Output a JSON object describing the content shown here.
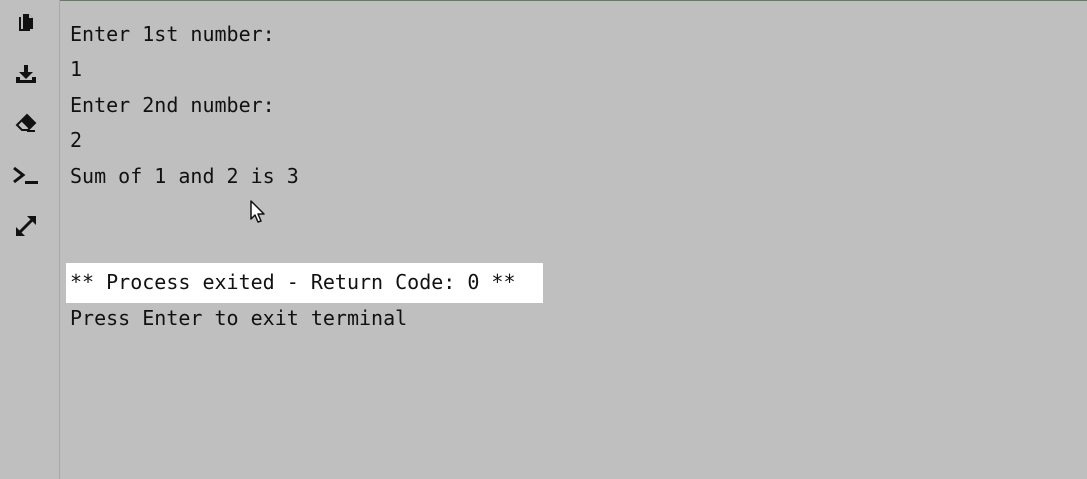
{
  "sidebar": {
    "tools": [
      {
        "icon": "copy-icon"
      },
      {
        "icon": "download-icon"
      },
      {
        "icon": "eraser-icon"
      },
      {
        "icon": "terminal-icon"
      },
      {
        "icon": "expand-icon"
      }
    ]
  },
  "terminal": {
    "lines": [
      "Enter 1st number:",
      "1",
      "Enter 2nd number:",
      "2",
      "Sum of 1 and 2 is 3"
    ],
    "exit_message": "** Process exited - Return Code: 0 **",
    "prompt_message": "Press Enter to exit terminal"
  },
  "colors": {
    "background": "#bfbfbf",
    "text": "#111111",
    "highlight": "#ffffff"
  }
}
